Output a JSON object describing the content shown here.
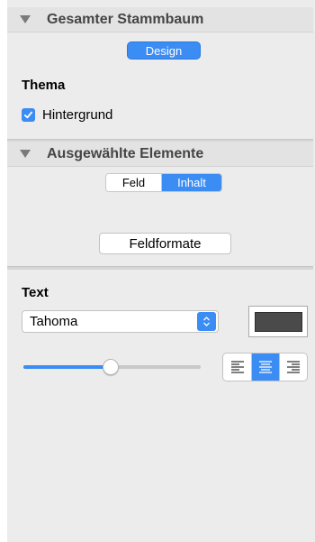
{
  "section1": {
    "title": "Gesamter Stammbaum",
    "tab_design": "Design"
  },
  "thema": {
    "heading": "Thema",
    "checkbox_label": "Hintergrund",
    "checked": true
  },
  "section2": {
    "title": "Ausgewählte Elemente",
    "seg_options": [
      "Feld",
      "Inhalt"
    ],
    "selected": "Inhalt"
  },
  "feldformate_label": "Feldformate",
  "text_section": {
    "heading": "Text",
    "font_value": "Tahoma",
    "color_hex": "#4a4a4a",
    "size_slider_fraction": 0.49,
    "alignment_selected": "center"
  },
  "colors": {
    "accent": "#3b8cf3",
    "panel_bg": "#ececec"
  }
}
